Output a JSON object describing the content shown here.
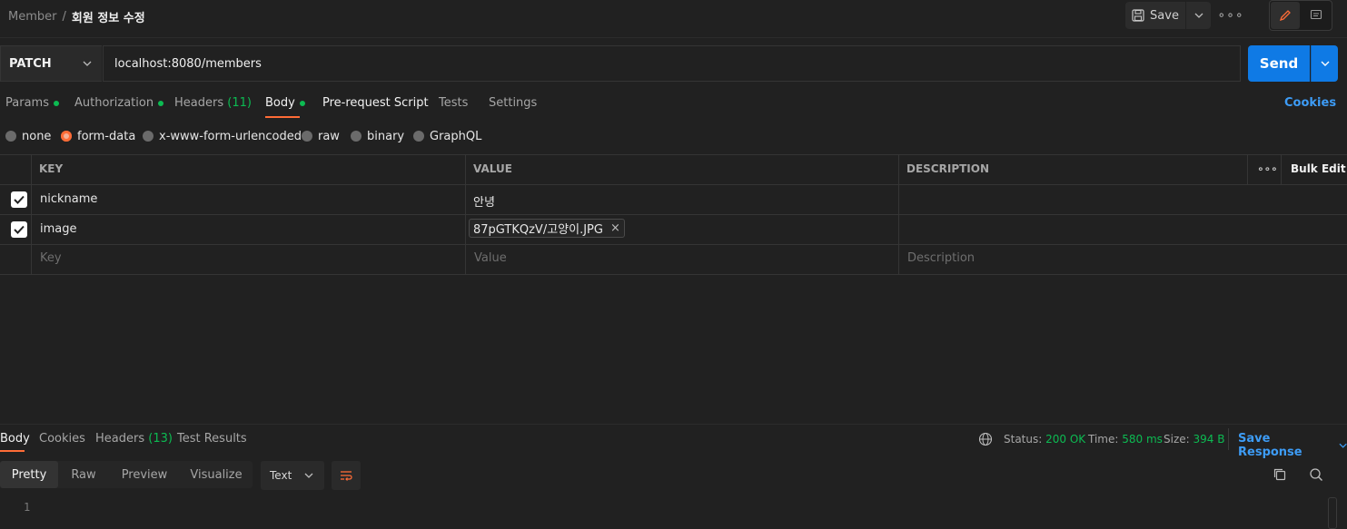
{
  "breadcrumb": {
    "parent": "Member",
    "separator": "/",
    "current": "회원 정보 수정"
  },
  "toolbar": {
    "save_label": "Save",
    "more_label": "∘∘∘"
  },
  "request": {
    "method": "PATCH",
    "url": "localhost:8080/members",
    "send_label": "Send"
  },
  "tabs": {
    "params": "Params",
    "authorization": "Authorization",
    "headers": "Headers",
    "headers_count": "(11)",
    "body": "Body",
    "prerequest": "Pre-request Script",
    "tests": "Tests",
    "settings": "Settings",
    "cookies": "Cookies"
  },
  "body_types": {
    "none": "none",
    "form_data": "form-data",
    "urlencoded": "x-www-form-urlencoded",
    "raw": "raw",
    "binary": "binary",
    "graphql": "GraphQL",
    "selected": "form-data"
  },
  "table": {
    "headers": {
      "key": "KEY",
      "value": "VALUE",
      "description": "DESCRIPTION",
      "more": "∘∘∘",
      "bulk_edit": "Bulk Edit"
    },
    "rows": [
      {
        "key": "nickname",
        "value": "안녕",
        "checked": true
      },
      {
        "key": "image",
        "file": "87pGTKQzV/고양이.JPG",
        "file_remove": "×",
        "checked": true
      }
    ],
    "placeholders": {
      "key": "Key",
      "value": "Value",
      "description": "Description"
    }
  },
  "response": {
    "tabs": {
      "body": "Body",
      "cookies": "Cookies",
      "headers": "Headers",
      "headers_count": "(13)",
      "test_results": "Test Results"
    },
    "status_label": "Status:",
    "status_value": "200 OK",
    "time_label": "Time:",
    "time_value": "580 ms",
    "size_label": "Size:",
    "size_value": "394 B",
    "save_response": "Save Response",
    "formats": {
      "pretty": "Pretty",
      "raw": "Raw",
      "preview": "Preview",
      "visualize": "Visualize"
    },
    "text_type": "Text",
    "line_number": "1"
  },
  "colors": {
    "accent": "#ff6c37",
    "primary": "#0f7ae5",
    "success": "#0cbb52",
    "link": "#3d9cf6"
  }
}
